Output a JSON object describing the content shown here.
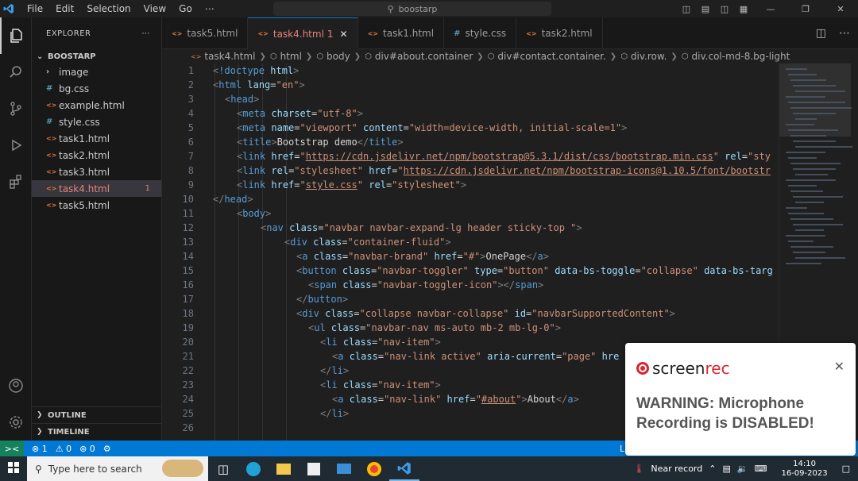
{
  "titlebar": {
    "menu": [
      "File",
      "Edit",
      "Selection",
      "View",
      "Go",
      "⋯"
    ],
    "search": "boostarp"
  },
  "explorer": {
    "title": "EXPLORER",
    "root": "BOOSTARP",
    "files": [
      {
        "name": "image",
        "kind": "folder"
      },
      {
        "name": "bg.css",
        "kind": "css"
      },
      {
        "name": "example.html",
        "kind": "html"
      },
      {
        "name": "style.css",
        "kind": "css"
      },
      {
        "name": "task1.html",
        "kind": "html"
      },
      {
        "name": "task2.html",
        "kind": "html"
      },
      {
        "name": "task3.html",
        "kind": "html"
      },
      {
        "name": "task4.html",
        "kind": "html",
        "active": true,
        "badge": "1"
      },
      {
        "name": "task5.html",
        "kind": "html"
      }
    ],
    "outline": "OUTLINE",
    "timeline": "TIMELINE"
  },
  "tabs": [
    {
      "label": "task5.html",
      "kind": "html"
    },
    {
      "label": "task4.html",
      "kind": "html",
      "active": true,
      "badge": "1"
    },
    {
      "label": "task1.html",
      "kind": "html"
    },
    {
      "label": "style.css",
      "kind": "css"
    },
    {
      "label": "task2.html",
      "kind": "html"
    }
  ],
  "breadcrumb": [
    "task4.html",
    "html",
    "body",
    "div#about.container",
    "div#contact.container.",
    "div.row.",
    "div.col-md-8.bg-light"
  ],
  "code_lines": [
    {
      "n": "1",
      "indent": 0,
      "html": "<span class='pu'>&lt;</span><span class='tg'>!doctype</span> <span class='at'>html</span><span class='pu'>&gt;</span>"
    },
    {
      "n": "2",
      "indent": 0,
      "html": "<span class='pu'>&lt;</span><span class='tg'>html</span> <span class='at'>lang</span>=<span class='st2'>\"en\"</span><span class='pu'>&gt;</span>"
    },
    {
      "n": "3",
      "indent": 1,
      "html": "<span class='pu'>&lt;</span><span class='tg'>head</span><span class='pu'>&gt;</span>"
    },
    {
      "n": "4",
      "indent": 2,
      "html": "<span class='pu'>&lt;</span><span class='tg'>meta</span> <span class='at'>charset</span>=<span class='st2'>\"utf-8\"</span><span class='pu'>&gt;</span>"
    },
    {
      "n": "5",
      "indent": 2,
      "html": "<span class='pu'>&lt;</span><span class='tg'>meta</span> <span class='at'>name</span>=<span class='st2'>\"viewport\"</span> <span class='at'>content</span>=<span class='st2'>\"width=device-width, initial-scale=1\"</span><span class='pu'>&gt;</span>"
    },
    {
      "n": "6",
      "indent": 2,
      "html": "<span class='pu'>&lt;</span><span class='tg'>title</span><span class='pu'>&gt;</span><span class='tx'>Bootstrap demo</span><span class='pu'>&lt;/</span><span class='tg'>title</span><span class='pu'>&gt;</span>"
    },
    {
      "n": "7",
      "indent": 2,
      "html": "<span class='pu'>&lt;</span><span class='tg'>link</span> <span class='at'>href</span>=<span class='st2'>\"<span class='ul'>https://cdn.jsdelivr.net/npm/bootstrap@5.3.1/dist/css/bootstrap.min.css</span>\"</span> <span class='at'>rel</span>=<span class='st2'>\"sty</span>"
    },
    {
      "n": "8",
      "indent": 2,
      "html": "<span class='pu'>&lt;</span><span class='tg'>link</span> <span class='at'>rel</span>=<span class='st2'>\"stylesheet\"</span> <span class='at'>href</span>=<span class='st2'>\"<span class='ul'>https://cdn.jsdelivr.net/npm/bootstrap-icons@1.10.5/font/bootstr</span></span>"
    },
    {
      "n": "9",
      "indent": 2,
      "html": "<span class='pu'>&lt;</span><span class='tg'>link</span> <span class='at'>href</span>=<span class='st2'>\"<span class='ul'>style.css</span>\"</span> <span class='at'>rel</span>=<span class='st2'>\"stylesheet\"</span><span class='pu'>&gt;</span>"
    },
    {
      "n": "10",
      "indent": 0,
      "html": "<span class='pu'>&lt;/</span><span class='tg'>head</span><span class='pu'>&gt;</span>"
    },
    {
      "n": "11",
      "indent": 2,
      "html": "<span class='pu'>&lt;</span><span class='tg'>body</span><span class='pu'>&gt;</span>"
    },
    {
      "n": "12",
      "indent": 4,
      "html": "<span class='pu'>&lt;</span><span class='tg'>nav</span> <span class='at'>class</span>=<span class='st2'>\"navbar navbar-expand-lg header sticky-top \"</span><span class='pu'>&gt;</span>"
    },
    {
      "n": "13",
      "indent": 6,
      "html": "<span class='pu'>&lt;</span><span class='tg'>div</span> <span class='at'>class</span>=<span class='st2'>\"container-fluid\"</span><span class='pu'>&gt;</span>"
    },
    {
      "n": "14",
      "indent": 7,
      "html": "<span class='pu'>&lt;</span><span class='tg'>a</span> <span class='at'>class</span>=<span class='st2'>\"navbar-brand\"</span> <span class='at'>href</span>=<span class='st2'>\"#\"</span><span class='pu'>&gt;</span><span class='tx'>OnePage</span><span class='pu'>&lt;/</span><span class='tg'>a</span><span class='pu'>&gt;</span>"
    },
    {
      "n": "15",
      "indent": 7,
      "html": "<span class='pu'>&lt;</span><span class='tg'>button</span> <span class='at'>class</span>=<span class='st2'>\"navbar-toggler\"</span> <span class='at'>type</span>=<span class='st2'>\"button\"</span> <span class='at'>data-bs-toggle</span>=<span class='st2'>\"collapse\"</span> <span class='at'>data-bs-targ</span>"
    },
    {
      "n": "16",
      "indent": 8,
      "html": "<span class='pu'>&lt;</span><span class='tg'>span</span> <span class='at'>class</span>=<span class='st2'>\"navbar-toggler-icon\"</span><span class='pu'>&gt;&lt;/</span><span class='tg'>span</span><span class='pu'>&gt;</span>"
    },
    {
      "n": "17",
      "indent": 7,
      "html": "<span class='pu'>&lt;/</span><span class='tg'>button</span><span class='pu'>&gt;</span>"
    },
    {
      "n": "18",
      "indent": 7,
      "html": "<span class='pu'>&lt;</span><span class='tg'>div</span> <span class='at'>class</span>=<span class='st2'>\"collapse navbar-collapse\"</span> <span class='at'>id</span>=<span class='st2'>\"navbarSupportedContent\"</span><span class='pu'>&gt;</span>"
    },
    {
      "n": "19",
      "indent": 8,
      "html": "<span class='pu'>&lt;</span><span class='tg'>ul</span> <span class='at'>class</span>=<span class='st2'>\"navbar-nav ms-auto mb-2 mb-lg-0\"</span><span class='pu'>&gt;</span>"
    },
    {
      "n": "20",
      "indent": 9,
      "html": "<span class='pu'>&lt;</span><span class='tg'>li</span> <span class='at'>class</span>=<span class='st2'>\"nav-item\"</span><span class='pu'>&gt;</span>"
    },
    {
      "n": "21",
      "indent": 10,
      "html": "<span class='pu'>&lt;</span><span class='tg'>a</span> <span class='at'>class</span>=<span class='st2'>\"nav-link active\"</span> <span class='at'>aria-current</span>=<span class='st2'>\"page\"</span> <span class='at'>hre</span>"
    },
    {
      "n": "22",
      "indent": 9,
      "html": "<span class='pu'>&lt;/</span><span class='tg'>li</span><span class='pu'>&gt;</span>"
    },
    {
      "n": "23",
      "indent": 9,
      "html": "<span class='pu'>&lt;</span><span class='tg'>li</span> <span class='at'>class</span>=<span class='st2'>\"nav-item\"</span><span class='pu'>&gt;</span>"
    },
    {
      "n": "24",
      "indent": 10,
      "html": "<span class='pu'>&lt;</span><span class='tg'>a</span> <span class='at'>class</span>=<span class='st2'>\"nav-link\"</span> <span class='at'>href</span>=<span class='st2'>\"<span class='ul'>#about</span>\"</span><span class='pu'>&gt;</span><span class='tx'>About</span><span class='pu'>&lt;/</span><span class='tg'>a</span><span class='pu'>&gt;</span>"
    },
    {
      "n": "25",
      "indent": 9,
      "html": "<span class='pu'>&lt;/</span><span class='tg'>li</span><span class='pu'>&gt;</span>"
    },
    {
      "n": "26",
      "indent": 0,
      "html": ""
    }
  ],
  "statusbar": {
    "errors": "1",
    "warnings": "0",
    "ports": "0",
    "position": "Ln"
  },
  "taskbar": {
    "search_placeholder": "Type here to search",
    "weather": "Near record",
    "time": "14:10",
    "date": "16-09-2023"
  },
  "popup": {
    "brand_screen": "screen",
    "brand_rec": "rec",
    "warning": "WARNING: Microphone Recording is DISABLED!"
  },
  "colors": {
    "accent": "#0078d4",
    "active_file": "#e5837a",
    "tag": "#569cd6",
    "attr": "#9cdcfe",
    "string": "#ce9178",
    "screenrec_red": "#d8262f"
  }
}
